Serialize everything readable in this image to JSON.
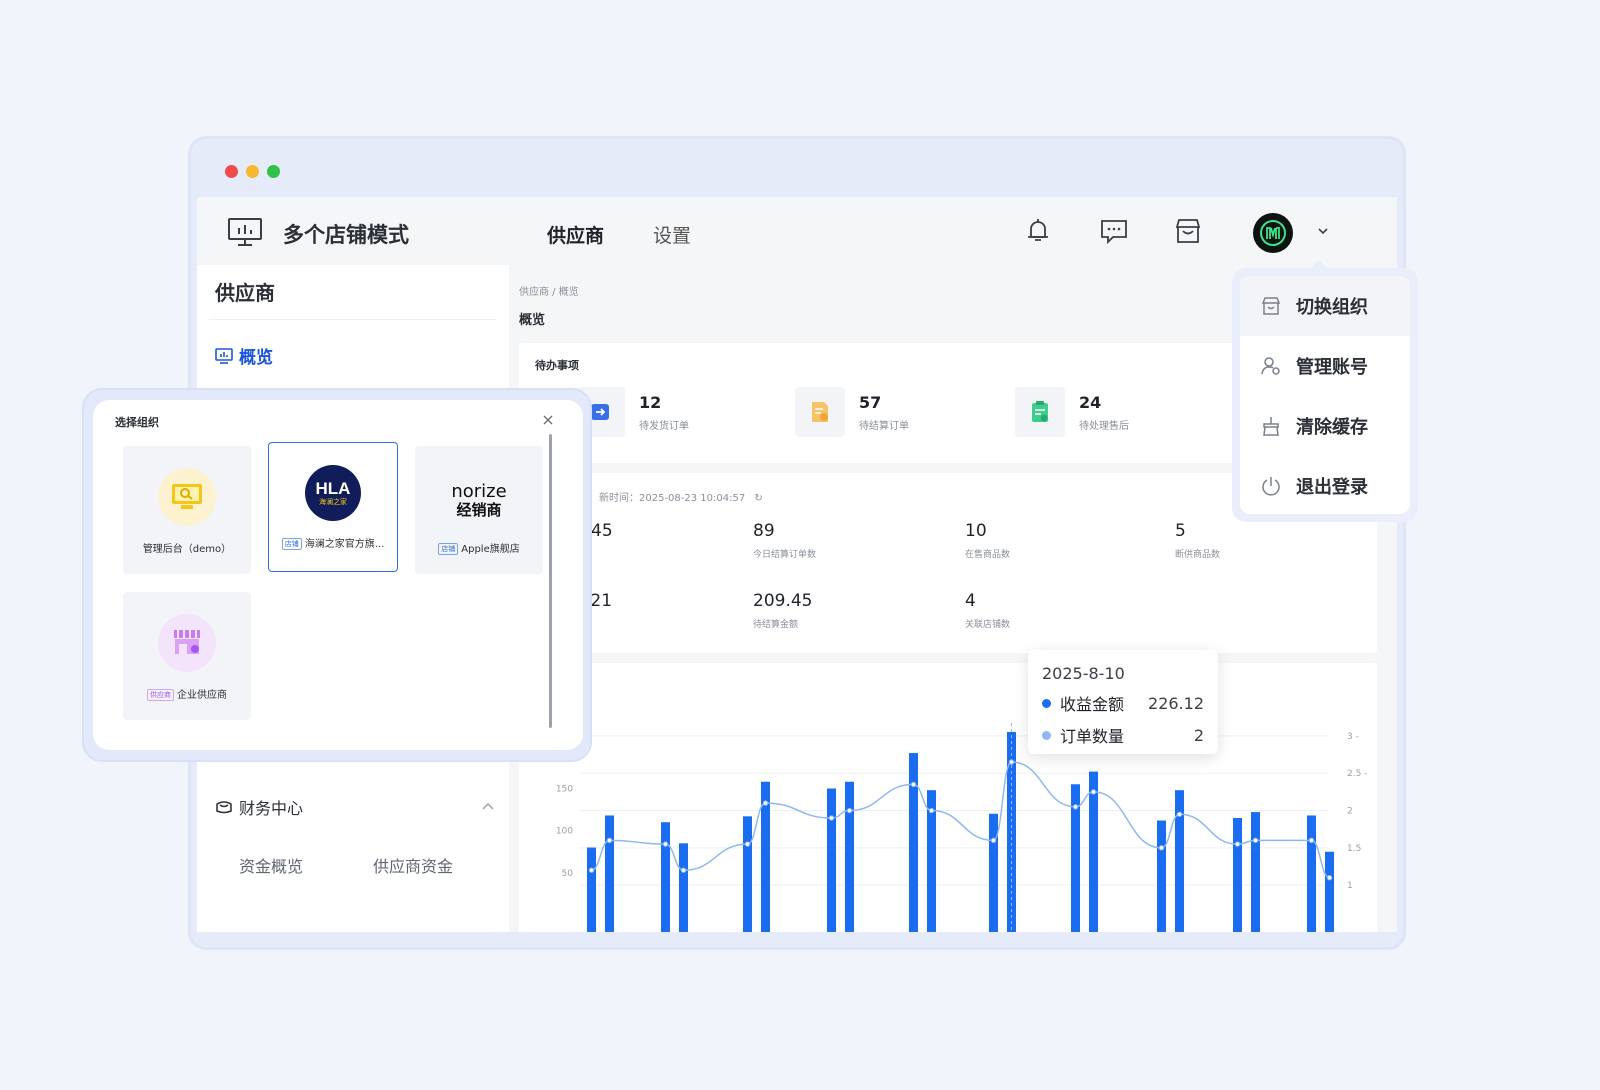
{
  "app": {
    "title": "多个店铺模式",
    "nav": [
      "供应商",
      "设置"
    ]
  },
  "header_icons": [
    "bell-icon",
    "message-icon",
    "store-icon"
  ],
  "sidebar": {
    "title": "供应商",
    "overview": "概览",
    "finance": "财务中心",
    "finance_sub": [
      "资金概览",
      "供应商资金"
    ]
  },
  "main": {
    "breadcrumb": "供应商 / 概览",
    "page_title": "概览",
    "todo": {
      "title": "待办事项",
      "items": [
        {
          "num": "12",
          "label": "待发货订单"
        },
        {
          "num": "57",
          "label": "待结算订单"
        },
        {
          "num": "24",
          "label": "待处理售后"
        }
      ]
    },
    "stats": {
      "update_time": "新时间：2025-08-23 10:04:57",
      "row1": [
        {
          "value": "45",
          "label": ""
        },
        {
          "value": "89",
          "label": "今日结算订单数"
        },
        {
          "value": "10",
          "label": "在售商品数"
        },
        {
          "value": "5",
          "label": "断供商品数"
        }
      ],
      "row2": [
        {
          "value": ".21",
          "label": ""
        },
        {
          "value": "209.45",
          "label": "待结算金额"
        },
        {
          "value": "4",
          "label": "关联店铺数"
        }
      ]
    }
  },
  "tooltip": {
    "date": "2025-8-10",
    "rows": [
      {
        "name": "收益金额",
        "value": "226.12",
        "color": "#1a6cf0"
      },
      {
        "name": "订单数量",
        "value": "2",
        "color": "#8fb8f2"
      }
    ]
  },
  "dropdown": {
    "items": [
      "切换组织",
      "管理账号",
      "清除缓存",
      "退出登录"
    ]
  },
  "modal": {
    "title": "选择组织",
    "orgs": [
      {
        "name": "管理后台（demo）",
        "tag": ""
      },
      {
        "name": "海澜之家官方旗...",
        "tag": "店铺",
        "logo_text": "HLA",
        "logo_sub": "海澜之家"
      },
      {
        "name": "Apple旗舰店",
        "tag": "店铺",
        "logo_text": "norize",
        "logo_sub": "经销商"
      },
      {
        "name": "企业供应商",
        "tag": "供应商"
      }
    ]
  },
  "chart_data": {
    "type": "bar",
    "y_left_ticks": [
      "50",
      "100",
      "150"
    ],
    "y_right_ticks": [
      "1",
      "1.5",
      "2",
      "2.5",
      "3"
    ],
    "series": [
      {
        "name": "收益金额",
        "type": "bar",
        "values": [
          80,
          118,
          110,
          85,
          117,
          158,
          150,
          158,
          192,
          148,
          120,
          217,
          155,
          170,
          112,
          148,
          115,
          122,
          118,
          75
        ]
      },
      {
        "name": "订单数量",
        "type": "line",
        "values": [
          1.2,
          1.6,
          1.55,
          1.2,
          1.55,
          2.1,
          1.9,
          2.0,
          2.35,
          2.0,
          1.6,
          2.65,
          2.05,
          2.25,
          1.5,
          1.95,
          1.55,
          1.6,
          1.6,
          1.1
        ]
      }
    ],
    "ylim_left": [
      0,
      230
    ],
    "ylim_right": [
      0.6,
      3.2
    ]
  }
}
